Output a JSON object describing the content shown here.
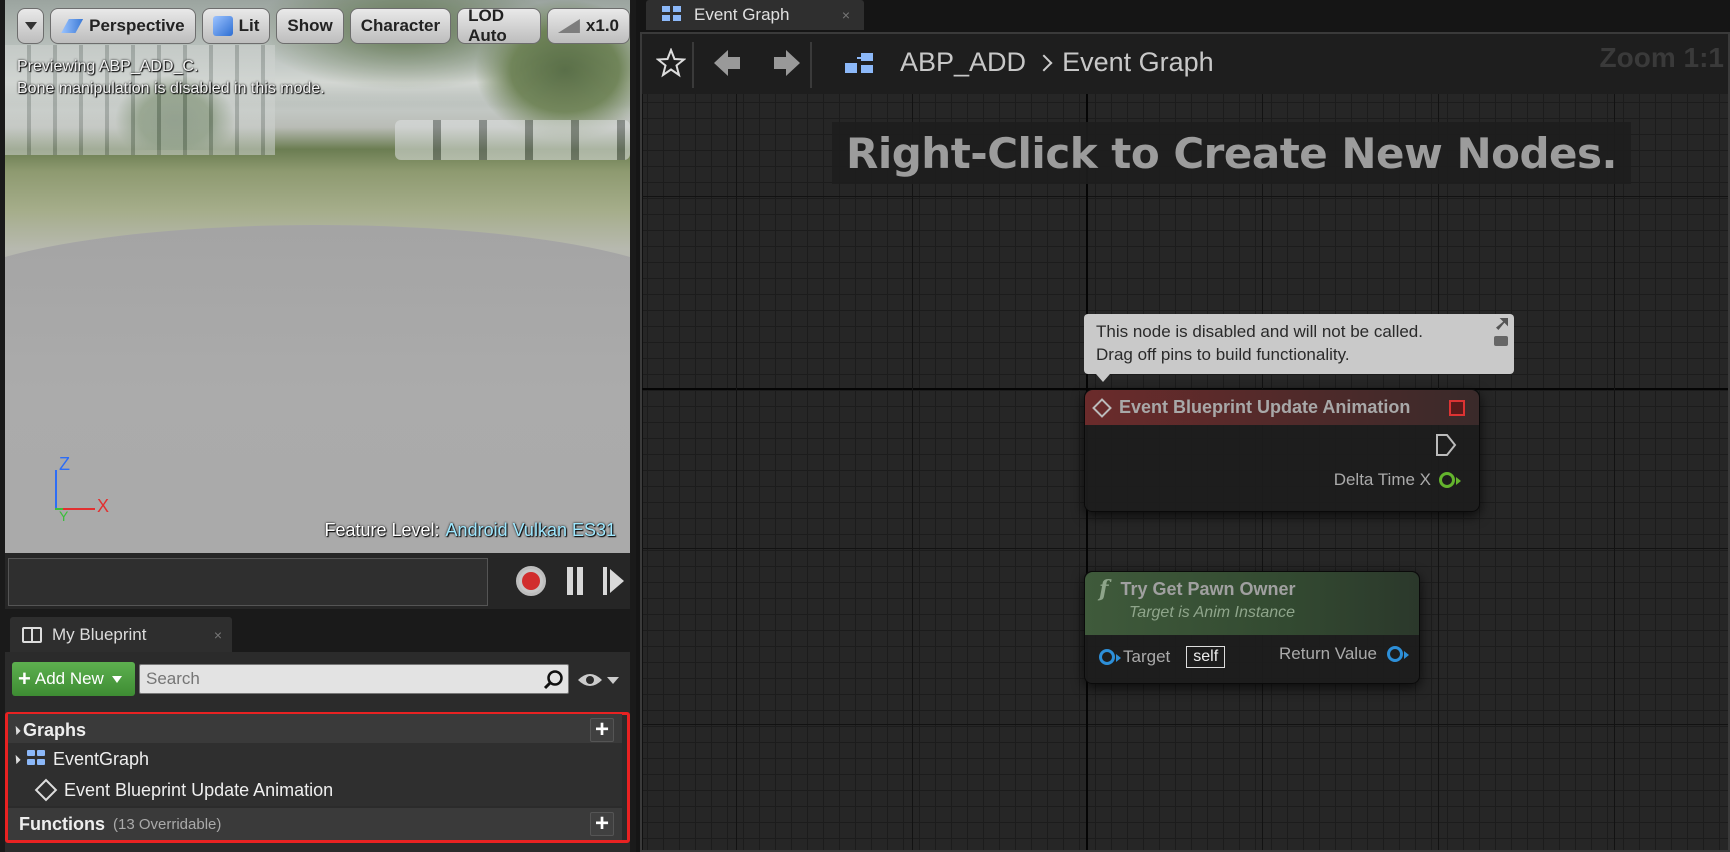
{
  "viewport": {
    "toolbar": {
      "perspective": "Perspective",
      "lit": "Lit",
      "show": "Show",
      "character": "Character",
      "lod": "LOD Auto",
      "speed": "x1.0"
    },
    "preview_line1": "Previewing ABP_ADD_C.",
    "preview_line2": "Bone manipulation is disabled in this mode.",
    "axes": {
      "z": "Z",
      "x": "X",
      "y": "Y"
    },
    "feature_level_label": "Feature Level:",
    "feature_level_value": "Android Vulkan ES31"
  },
  "my_blueprint": {
    "tab_label": "My Blueprint",
    "add_new_label": "Add New",
    "search_placeholder": "Search",
    "graphs_label": "Graphs",
    "event_graph_label": "EventGraph",
    "event_node_label": "Event Blueprint Update Animation",
    "functions_label": "Functions",
    "functions_count": "(13 Overridable)"
  },
  "graph_editor": {
    "tab_label": "Event Graph",
    "breadcrumb_root": "ABP_ADD",
    "breadcrumb_current": "Event Graph",
    "zoom": "Zoom 1:1",
    "hint": "Right-Click to Create New Nodes.",
    "comment_line1": "This node is disabled and will not be called.",
    "comment_line2": "Drag off pins to build functionality.",
    "event_node": {
      "title": "Event Blueprint Update Animation",
      "pin_delta": "Delta Time X"
    },
    "function_node": {
      "title": "Try Get Pawn Owner",
      "subtitle": "Target is Anim Instance",
      "pin_target": "Target",
      "target_default": "self",
      "pin_return": "Return Value"
    }
  },
  "colors": {
    "highlight_border": "#e82222",
    "add_new_green": "#4a9e3e",
    "event_header": "#6b2b2b",
    "function_header": "#3f5a3b",
    "float_pin": "#64b42d",
    "object_pin": "#2d8fd8"
  }
}
